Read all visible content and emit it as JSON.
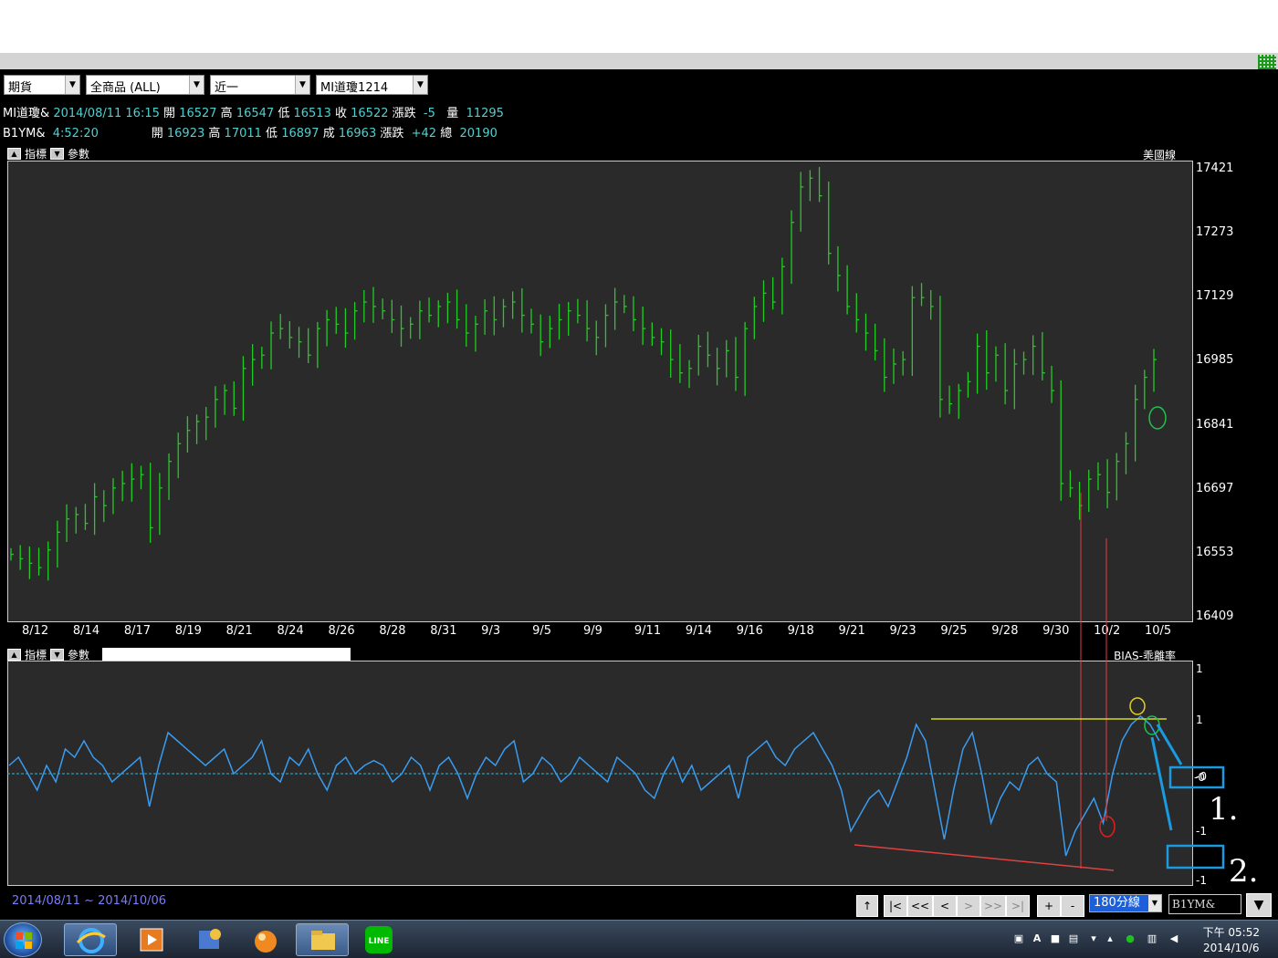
{
  "toolbar": {
    "market": "期貨",
    "category": "全商品 (ALL)",
    "month": "近一",
    "product": "MI道瓊1214"
  },
  "quote1": {
    "symbol": "MI道瓊&",
    "datetime": "2014/08/11 16:15",
    "open_label": "開",
    "open": "16527",
    "high_label": "高",
    "high": "16547",
    "low_label": "低",
    "low": "16513",
    "close_label": "收",
    "close": "16522",
    "change_label": "漲跌",
    "change": "-5",
    "volume_label": "量",
    "volume": "11295"
  },
  "quote2": {
    "symbol": "B1YM&",
    "time": "4:52:20",
    "open_label": "開",
    "open": "16923",
    "high_label": "高",
    "high": "17011",
    "low_label": "低",
    "low": "16897",
    "close_label": "成",
    "close": "16963",
    "change_label": "漲跌",
    "change": "+42",
    "volume_label": "總",
    "volume": "20190"
  },
  "main_panel": {
    "indicator_label": "指標",
    "param_label": "參數",
    "title": "美國線"
  },
  "ind_panel": {
    "indicator_label": "指標",
    "param_label": "參數",
    "title": "BIAS-乖離率"
  },
  "chart_data": [
    {
      "type": "ohlc",
      "title": "美國線",
      "x_ticks": [
        "8/12",
        "8/14",
        "8/17",
        "8/19",
        "8/21",
        "8/24",
        "8/26",
        "8/28",
        "8/31",
        "9/3",
        "9/5",
        "9/9",
        "9/11",
        "9/14",
        "9/16",
        "9/18",
        "9/21",
        "9/23",
        "9/25",
        "9/28",
        "9/30",
        "10/2",
        "10/5"
      ],
      "y_ticks": [
        "17421",
        "17273",
        "17129",
        "16985",
        "16841",
        "16697",
        "16553",
        "16409"
      ],
      "ylim": [
        16409,
        17421
      ],
      "series": [
        {
          "values": [
            16550,
            16540,
            16530,
            16520,
            16560,
            16600,
            16630,
            16640,
            16620,
            16680,
            16660,
            16700,
            16710,
            16720,
            16730,
            16610,
            16700,
            16760,
            16800,
            16830,
            16850,
            16860,
            16900,
            16920,
            16880,
            16970,
            16990,
            17000,
            17050,
            17060,
            17040,
            17030,
            17000,
            17060,
            17080,
            17070,
            17050,
            17100,
            17120,
            17110,
            17100,
            17080,
            17060,
            17070,
            17100,
            17090,
            17110,
            17120,
            17080,
            17050,
            17070,
            17100,
            17080,
            17110,
            17120,
            17090,
            17070,
            17030,
            17060,
            17080,
            17100,
            17090,
            17060,
            17040,
            17090,
            17120,
            17110,
            17080,
            17060,
            17040,
            17030,
            16990,
            16960,
            16970,
            17020,
            17000,
            16970,
            17010,
            16950,
            17060,
            17110,
            17140,
            17120,
            17200,
            17300,
            17380,
            17400,
            17360,
            17230,
            17180,
            17110,
            17080,
            17050,
            17010,
            16950,
            16980,
            16990,
            17130,
            17130,
            17110,
            16900,
            16890,
            16920,
            16940,
            17020,
            16960,
            17000,
            16920,
            16980,
            16990,
            17020,
            16960,
            16920,
            16710,
            16700,
            16660,
            16720,
            16730,
            16690,
            16760,
            16800,
            16900,
            16950,
            16990
          ]
        }
      ]
    },
    {
      "type": "line",
      "title": "BIAS-乖離率",
      "y_ticks": [
        "1",
        "1",
        "-0",
        "-1",
        "-1"
      ],
      "series": [
        {
          "values": [
            0.05,
            0.1,
            0.0,
            -0.1,
            0.05,
            -0.05,
            0.15,
            0.1,
            0.2,
            0.1,
            0.05,
            -0.05,
            0.0,
            0.05,
            0.1,
            -0.2,
            0.05,
            0.25,
            0.2,
            0.15,
            0.1,
            0.05,
            0.1,
            0.15,
            0.0,
            0.05,
            0.1,
            0.2,
            0.0,
            -0.05,
            0.1,
            0.05,
            0.15,
            0.0,
            -0.1,
            0.05,
            0.1,
            0.0,
            0.05,
            0.08,
            0.05,
            -0.05,
            0.0,
            0.1,
            0.05,
            -0.1,
            0.05,
            0.1,
            0.0,
            -0.15,
            0.0,
            0.1,
            0.05,
            0.15,
            0.2,
            -0.05,
            0.0,
            0.1,
            0.05,
            -0.05,
            0.0,
            0.1,
            0.05,
            0.0,
            -0.05,
            0.1,
            0.05,
            0.0,
            -0.1,
            -0.15,
            0.0,
            0.1,
            -0.05,
            0.05,
            -0.1,
            -0.05,
            0.0,
            0.05,
            -0.15,
            0.1,
            0.15,
            0.2,
            0.1,
            0.05,
            0.15,
            0.2,
            0.25,
            0.15,
            0.05,
            -0.1,
            -0.35,
            -0.25,
            -0.15,
            -0.1,
            -0.2,
            -0.05,
            0.1,
            0.3,
            0.2,
            -0.1,
            -0.4,
            -0.1,
            0.15,
            0.25,
            0.0,
            -0.3,
            -0.15,
            -0.05,
            -0.1,
            0.05,
            0.1,
            0.0,
            -0.05,
            -0.5,
            -0.35,
            -0.25,
            -0.15,
            -0.3,
            0.0,
            0.2,
            0.3,
            0.35,
            0.3,
            0.2
          ]
        }
      ]
    }
  ],
  "annotations": {
    "label1": "1.",
    "label2": "2.",
    "box1_value": "-0"
  },
  "bottom": {
    "date_from": "2014/08/11",
    "tilde": "~",
    "date_to": "2014/10/06",
    "nav": [
      "↑",
      "|<",
      "<<",
      "<",
      ">",
      ">>",
      ">|",
      "+",
      "-"
    ],
    "period": "180分線",
    "symbol": "B1YM&",
    "dropdown": "▼"
  },
  "taskbar": {
    "clock_time": "下午 05:52",
    "clock_date": "2014/10/6",
    "apps": [
      "ie-icon",
      "media-player-icon",
      "app-icon",
      "orange-app-icon",
      "file-explorer-icon",
      "line-icon"
    ]
  }
}
